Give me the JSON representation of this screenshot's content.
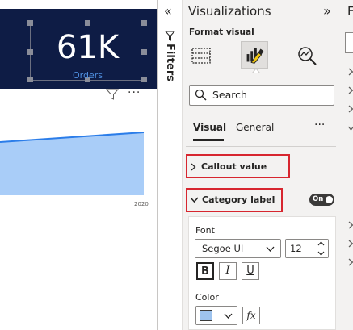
{
  "canvas": {
    "kpi_value": "61K",
    "kpi_label": "Orders",
    "x_tick": "2020",
    "more_options": "···"
  },
  "filters": {
    "title": "Filters",
    "collapse_glyph": "«"
  },
  "visualizations": {
    "title": "Visualizations",
    "expand_glyph": "»",
    "format_visual_label": "Format visual",
    "search_placeholder": "Search",
    "tabs": [
      {
        "label": "Visual",
        "selected": true
      },
      {
        "label": "General",
        "selected": false
      }
    ],
    "tabs_more": "···",
    "sections": {
      "callout_value": {
        "label": "Callout value",
        "expanded": false
      },
      "category_label": {
        "label": "Category label",
        "expanded": true,
        "toggle": "On"
      }
    },
    "font": {
      "label": "Font",
      "family": "Segoe UI",
      "size": "12",
      "bold": "B",
      "italic": "I",
      "underline": "U"
    },
    "color": {
      "label": "Color",
      "swatch": "#9ec3ee",
      "fx": "fx"
    }
  },
  "fields": {
    "title_partial": "F"
  },
  "colors": {
    "kpi_background": "#0e1c45",
    "kpi_label": "#4f8fe0",
    "area_fill": "#a9cdf8",
    "area_line": "#2b7de9",
    "highlight_border": "#d7262f",
    "pane_background": "#f3f2f1"
  }
}
